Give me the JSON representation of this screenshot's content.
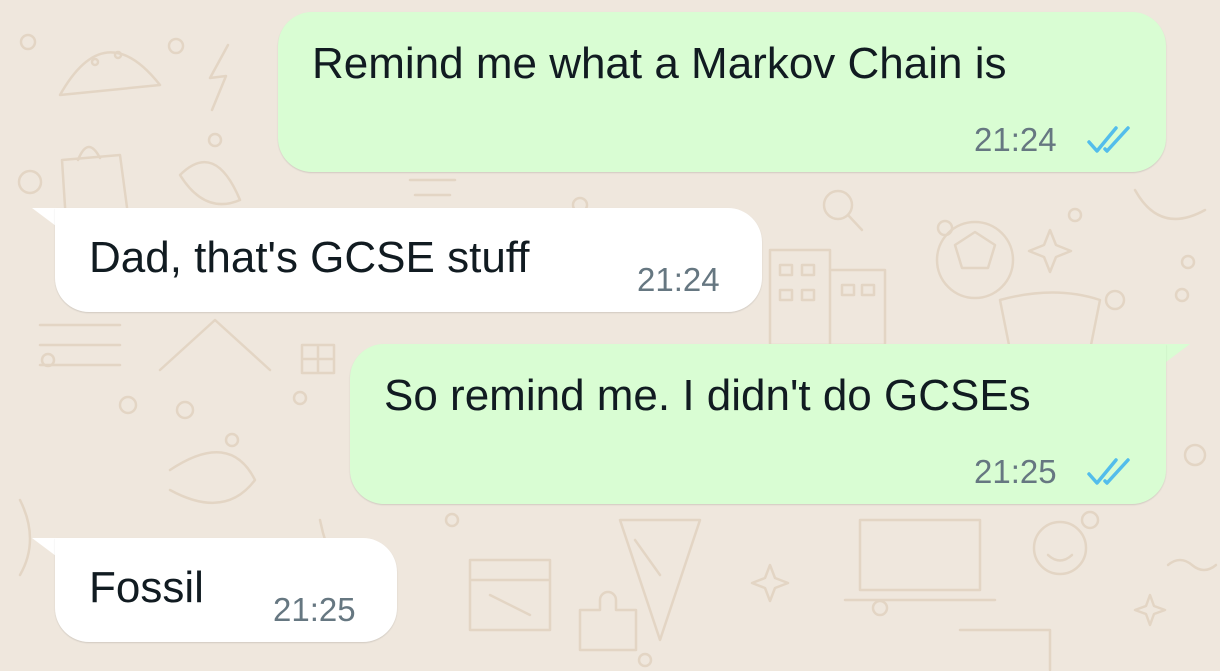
{
  "chat": {
    "messages": [
      {
        "direction": "outgoing",
        "text": "Remind me what a Markov Chain is",
        "time": "21:24",
        "status": "read"
      },
      {
        "direction": "incoming",
        "text": "Dad, that's GCSE stuff",
        "time": "21:24"
      },
      {
        "direction": "outgoing",
        "text": "So remind me. I didn't do GCSEs",
        "time": "21:25",
        "status": "read"
      },
      {
        "direction": "incoming",
        "text": "Fossil",
        "time": "21:25"
      }
    ]
  },
  "colors": {
    "wallpaper": "#efe7dd",
    "outgoing_bubble": "#d9fdd3",
    "incoming_bubble": "#ffffff",
    "read_ticks": "#53bdeb",
    "timestamp": "#667781",
    "message_text": "#111b21"
  },
  "icons": {
    "read_receipt": "double-check-icon"
  }
}
